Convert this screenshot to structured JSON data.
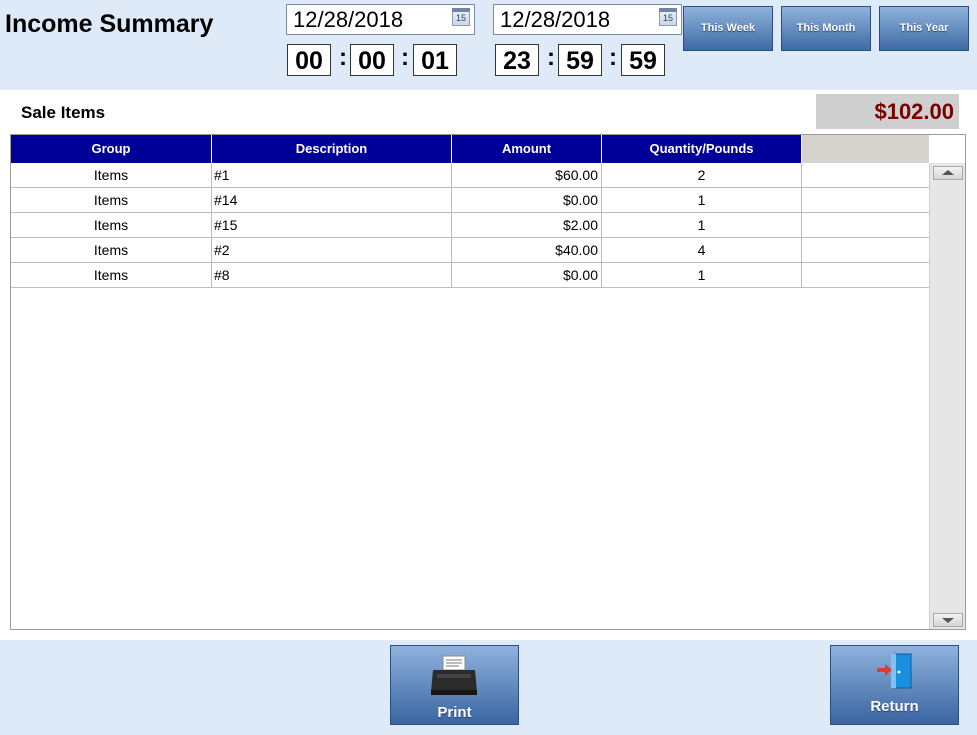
{
  "header": {
    "title": "Income Summary",
    "start": {
      "date": "12/28/2018",
      "calendar_day": "15",
      "hour": "00",
      "minute": "00",
      "second": "01"
    },
    "end": {
      "date": "12/28/2018",
      "calendar_day": "15",
      "hour": "23",
      "minute": "59",
      "second": "59"
    },
    "time_separator": ":",
    "range_buttons": {
      "week": "This Week",
      "month": "This Month",
      "year": "This Year"
    }
  },
  "section": {
    "label": "Sale Items",
    "total": "$102.00",
    "total_color": "#7a0000"
  },
  "table": {
    "columns": [
      "Group",
      "Description",
      "Amount",
      "Quantity/Pounds"
    ],
    "header_color": "#000099",
    "rows": [
      {
        "group": "Items",
        "description": "#1",
        "amount": "$60.00",
        "quantity": "2"
      },
      {
        "group": "Items",
        "description": "#14",
        "amount": "$0.00",
        "quantity": "1"
      },
      {
        "group": "Items",
        "description": "#15",
        "amount": "$2.00",
        "quantity": "1"
      },
      {
        "group": "Items",
        "description": "#2",
        "amount": "$40.00",
        "quantity": "4"
      },
      {
        "group": "Items",
        "description": "#8",
        "amount": "$0.00",
        "quantity": "1"
      }
    ]
  },
  "footer": {
    "print_label": "Print",
    "return_label": "Return",
    "print_icon": "printer-icon",
    "return_icon": "door-exit-icon"
  }
}
